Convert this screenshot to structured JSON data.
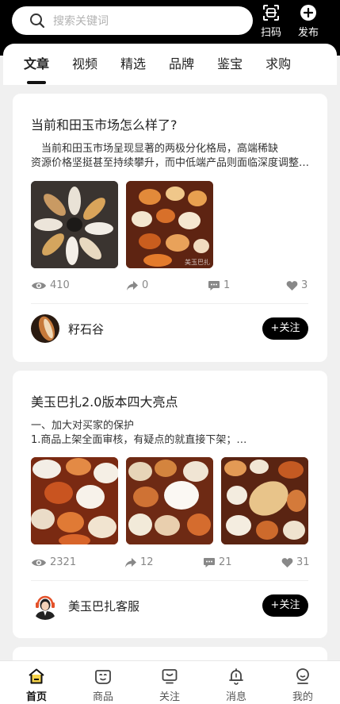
{
  "header": {
    "search_placeholder": "搜索关键词",
    "scan_label": "扫码",
    "publish_label": "发布"
  },
  "tabs": [
    {
      "label": "文章",
      "active": true
    },
    {
      "label": "视频"
    },
    {
      "label": "精选"
    },
    {
      "label": "品牌"
    },
    {
      "label": "鉴宝"
    },
    {
      "label": "求购"
    }
  ],
  "posts": [
    {
      "title": "当前和田玉市场怎么样了?",
      "excerpt_lines": [
        "　当前和田玉市场呈现显著的两极分化格局，高端稀缺",
        "资源价格坚挺甚至持续攀升，而中低端产品则面临深度调整…"
      ],
      "image_watermark": "美玉巴扎",
      "views": "410",
      "shares": "0",
      "comments": "1",
      "likes": "3",
      "author": "籽石谷",
      "follow_label": "+关注"
    },
    {
      "title": "美玉巴扎2.0版本四大亮点",
      "excerpt_lines": [
        "一、加大对买家的保护",
        "1.商品上架全面审核，有疑点的就直接下架；…"
      ],
      "views": "2321",
      "shares": "12",
      "comments": "21",
      "likes": "31",
      "author": "美玉巴扎客服",
      "follow_label": "+关注"
    }
  ],
  "bottom_nav": [
    {
      "label": "首页",
      "icon": "home-icon",
      "active": true
    },
    {
      "label": "商品",
      "icon": "bag-icon"
    },
    {
      "label": "关注",
      "icon": "follow-icon"
    },
    {
      "label": "消息",
      "icon": "bell-icon"
    },
    {
      "label": "我的",
      "icon": "profile-icon"
    }
  ],
  "colors": {
    "header_bg": "#000000",
    "page_bg": "#f0f0f0",
    "card_bg": "#ffffff",
    "follow_button_bg": "#000000",
    "stat_text": "#888888"
  }
}
